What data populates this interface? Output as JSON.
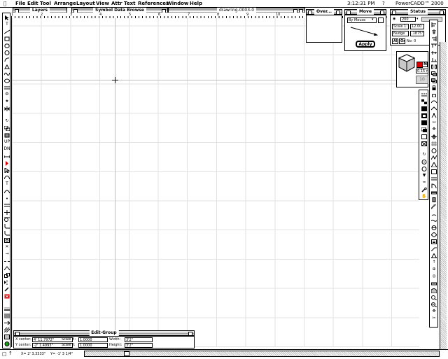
{
  "menubar": {
    "items": [
      "File",
      "Edit",
      "Tool",
      "Arrange",
      "Layout",
      "View",
      "Attr",
      "Text",
      "References",
      "Window",
      "Help"
    ],
    "clock": "3:12:31 PM",
    "app_name": "PowerCADD™ 2000"
  },
  "windows": {
    "layers_title": "Layers",
    "symbol_browser_title": "Symbol Data Browse",
    "drawing_title": "drawring-0003-0",
    "overview_title": "Over...",
    "move_title": "Move",
    "status_title": "Status",
    "edit_group_title": "Edit-Group"
  },
  "ruler": {
    "labels": [
      "1",
      "2",
      "3",
      "4",
      "5",
      "6",
      "7",
      "8",
      "9",
      "10",
      "11",
      "12",
      "13"
    ]
  },
  "move_palette": {
    "mode": "By Mouse",
    "apply_label": "Apply"
  },
  "status_palette": {
    "zoom": "200",
    "scale_label": "Scale",
    "scale_a": "1:",
    "scale_b": "12.00",
    "nudge_label": "Nudge",
    "nudge_value": ".1875\"",
    "all_label": "All",
    "on_label": "On",
    "no_label": "No: 0"
  },
  "attr_palette": {
    "pen_letter": "N",
    "line_weight": "0.15 m",
    "layer_num": "10"
  },
  "edit_group": {
    "x_center_label": "X center:",
    "x_center_value": "4' 11.7972\"",
    "y_center_label": "Y center:",
    "y_center_value": "-2' 1.4993\"",
    "scale_x_label": "Scale X:",
    "scale_x_value": "1.0000",
    "scale_y_label": "Scale Y:",
    "scale_y_value": "1.0000",
    "width_label": "Width:",
    "width_value": "3'2\"",
    "height_label": "Height:",
    "height_value": "3'2\""
  },
  "statusbar": {
    "coords": "X= 2' 3.3333\"",
    "y_coord": "Y= -1' 3 1/4\""
  },
  "colors": {
    "accent_red": "#d40000",
    "grid": "#e2e2e2"
  }
}
